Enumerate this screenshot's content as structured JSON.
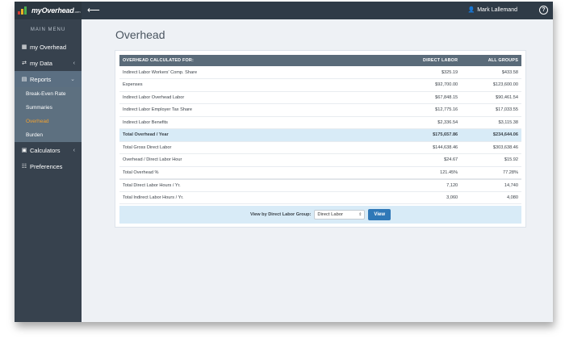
{
  "app": {
    "brand": "myOverhead",
    "brand_suffix": ".com",
    "user_name": "Mark Lallemand",
    "help_label": "?",
    "back_label": "⟵"
  },
  "sidebar": {
    "title": "MAIN MENU",
    "items": [
      {
        "label": "my Overhead",
        "icon": "grid-icon",
        "glyph": "▦"
      },
      {
        "label": "my Data",
        "icon": "sliders-icon",
        "glyph": "⇄",
        "chevron": "‹"
      },
      {
        "label": "Reports",
        "icon": "report-icon",
        "glyph": "▤",
        "chevron": "⌄"
      },
      {
        "label": "Calculators",
        "icon": "calculator-icon",
        "glyph": "▣",
        "chevron": "‹"
      },
      {
        "label": "Preferences",
        "icon": "preferences-icon",
        "glyph": "☷"
      }
    ],
    "reports_sub": [
      "Break-Even Rate",
      "Summaries",
      "Overhead",
      "Burden"
    ]
  },
  "main": {
    "title": "Overhead",
    "table": {
      "headers": [
        "OVERHEAD CALCULATED FOR:",
        "DIRECT LABOR",
        "ALL GROUPS"
      ],
      "rows": [
        [
          "Indirect Labor Workers' Comp. Share",
          "$325.19",
          "$433.58"
        ],
        [
          "Expenses",
          "$92,700.00",
          "$123,600.00"
        ],
        [
          "Indirect Labor Overhead Labor",
          "$67,848.15",
          "$90,461.54"
        ],
        [
          "Indirect Labor Employer Tax Share",
          "$12,775.16",
          "$17,033.55"
        ],
        [
          "Indirect Labor Benefits",
          "$2,336.54",
          "$3,115.38"
        ],
        [
          "Total Overhead / Year",
          "$175,657.86",
          "$234,644.06"
        ],
        [
          "Total Gross Direct Labor",
          "$144,638.46",
          "$303,638.46"
        ],
        [
          "Overhead / Direct Labor Hour",
          "$24.67",
          "$15.92"
        ],
        [
          "Total Overhead %",
          "121.45%",
          "77.28%"
        ],
        [
          "Total Direct Labor Hours / Yr.",
          "7,120",
          "14,740"
        ],
        [
          "Total Indirect Labor Hours / Yr.",
          "3,060",
          "4,080"
        ]
      ]
    },
    "footer": {
      "label": "View by Direct Labor Group:",
      "selected": "Direct Labor",
      "button": "View"
    }
  },
  "colors": {
    "topbar": "#2f3b47",
    "sidebar": "#37424e",
    "accent": "#2f78b7",
    "highlight_row": "#d8ebf7",
    "current_sub": "#f0a030"
  }
}
